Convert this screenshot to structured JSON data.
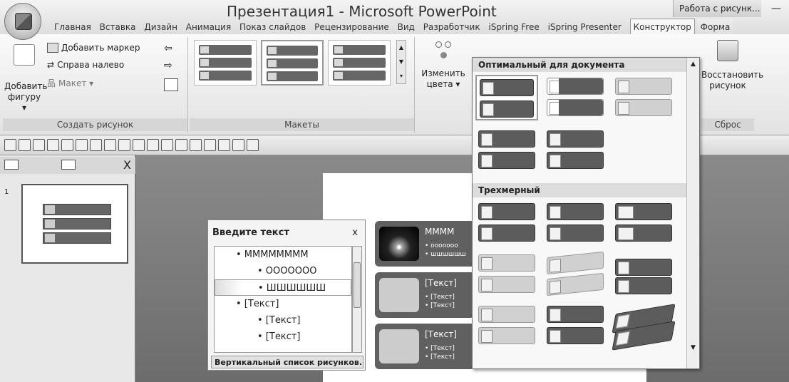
{
  "title": "Презентация1 - Microsoft PowerPoint",
  "context_label": "Работа с рисунк...",
  "minimize_glyph": "—",
  "tabs": [
    "Главная",
    "Вставка",
    "Дизайн",
    "Анимация",
    "Показ слайдов",
    "Рецензирование",
    "Вид",
    "Разработчик",
    "iSpring Free",
    "iSpring Presenter",
    "Конструктор",
    "Форма"
  ],
  "ribbon": {
    "create_graphic": {
      "add_shape_line1": "Добавить",
      "add_shape_line2": "фигуру ▾",
      "add_bullet": "Добавить маркер",
      "right_to_left": "Справа налево",
      "layout": "Макет ▾",
      "group_label": "Создать рисунок"
    },
    "layouts": {
      "group_label": "Макеты"
    },
    "change_colors_line1": "Изменить",
    "change_colors_line2": "цвета ▾",
    "reset": {
      "restore_line1": "Восстановить",
      "restore_line2": "рисунок",
      "group_label": "Сброс"
    }
  },
  "left_pane": {
    "close": "X",
    "slide_number": "1"
  },
  "text_pane": {
    "title": "Введите текст",
    "close": "x",
    "items": [
      {
        "text": "• ММММММММ",
        "level": 1
      },
      {
        "text": "• ООООООО",
        "level": 2
      },
      {
        "text": "• ШШШШШШ",
        "level": 2
      },
      {
        "text": "• [Текст]",
        "level": 1
      },
      {
        "text": "• [Текст]",
        "level": 2
      },
      {
        "text": "• [Текст]",
        "level": 2
      }
    ],
    "footer": "Вертикальный список рисунков..."
  },
  "smartart": {
    "row1_head": "ММММ",
    "row1_sub1": "• ооооооо",
    "row1_sub2": "• шшшшшш",
    "row2_head": "[Текст]",
    "row2_sub1": "• [Текст]",
    "row2_sub2": "• [Текст]",
    "row3_head": "[Текст]",
    "row3_sub1": "• [Текст]",
    "row3_sub2": "• [Текст]"
  },
  "gallery": {
    "section1": "Оптимальный для документа",
    "section2": "Трехмерный"
  }
}
